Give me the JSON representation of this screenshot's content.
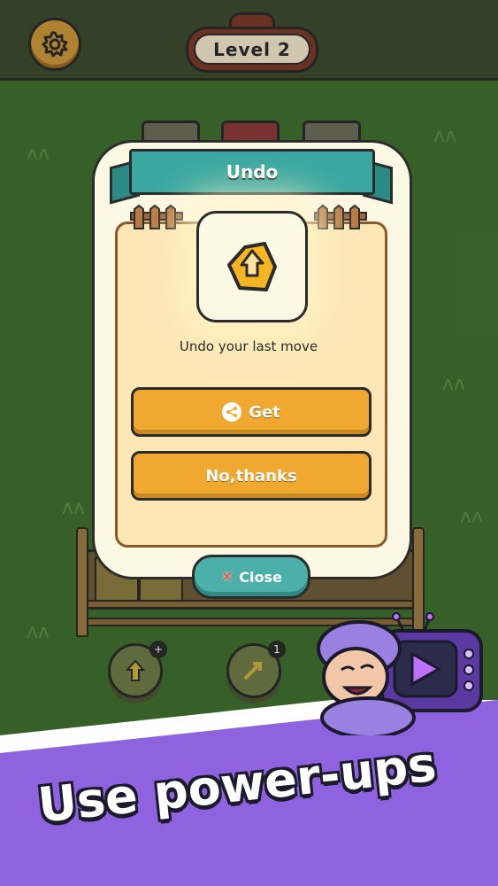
{
  "hud": {
    "level_label": "Level 2"
  },
  "dialog": {
    "title": "Undo",
    "description": "Undo your last move",
    "get_label": "Get",
    "no_thanks_label": "No,thanks",
    "close_label": "Close"
  },
  "toolbar": {
    "tool2_count": "1",
    "tool1_badge": "+"
  },
  "promo": {
    "tagline": "Use power-ups"
  },
  "colors": {
    "ribbon": "#3aa8a0",
    "button": "#f0a830",
    "close": "#4ab0a8",
    "banner": "#8f63e0"
  },
  "icons": [
    "gear-icon",
    "undo-icon",
    "share-icon",
    "close-x-icon",
    "play-icon"
  ]
}
